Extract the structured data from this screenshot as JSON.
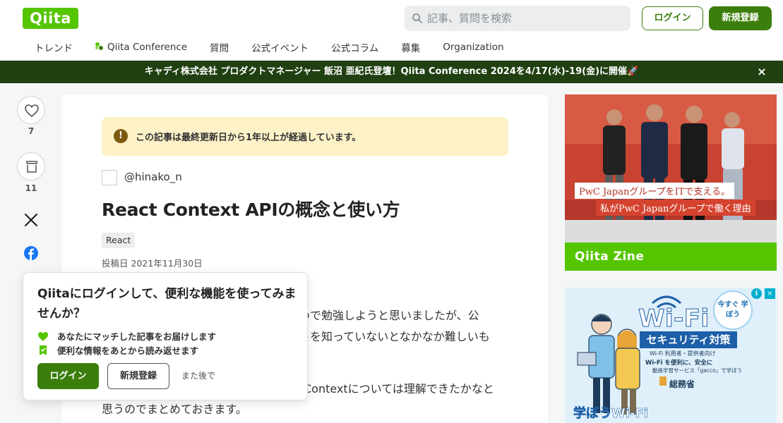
{
  "header": {
    "logo": "Qiita",
    "search_placeholder": "記事、質問を検索",
    "login_label": "ログイン",
    "signup_label": "新規登録"
  },
  "nav": {
    "items": [
      "トレンド",
      "Qiita Conference",
      "質問",
      "公式イベント",
      "公式コラム",
      "募集",
      "Organization"
    ]
  },
  "banner": {
    "text": "キャディ株式会社 プロダクトマネージャー 飯沼 亜紀氏登壇！Qiita Conference 2024を4/17(水)-19(金)に開催🚀",
    "close": "×"
  },
  "rail": {
    "like_count": "7",
    "stock_count": "11"
  },
  "article": {
    "notice": "この記事は最終更新日から1年以上が経過しています。",
    "notice_icon": "!",
    "author": "@hinako_n",
    "title": "React Context APIの概念と使い方",
    "tag": "React",
    "posted_label": "投稿日",
    "posted_date": "2021年11月30日",
    "body_line1": "ので勉強しようと思いましたが、公",
    "body_line2": "トを知っていないとなかなか難しいも",
    "body_line3": "Contextについては理解できたかなと",
    "body_line4": "思うのでまとめておきます。"
  },
  "modal": {
    "title": "Qiitaにログインして、便利な機能を使ってみませんか？",
    "benefit1": "あなたにマッチした記事をお届けします",
    "benefit2": "便利な情報をあとから読み返せます",
    "login_label": "ログイン",
    "signup_label": "新規登録",
    "later_label": "また後で"
  },
  "ads": {
    "ad1_caption1": "PwC JapanグループをITで支える。",
    "ad1_caption2": "私がPwC Japanグループで働く理由",
    "ad1_footer": "Qiita Zine",
    "ad2_badge": "今すぐ 学ぼう",
    "ad2_wifi": "Wi-Fi",
    "ad2_security": "セキュリティ対策",
    "ad2_sub1": "Wi-Fi 利用者・提供者向け",
    "ad2_sub2": "Wi-Fi を便利に、安全に",
    "ad2_sub3": "動画学習サービス「gacco」で学ぼう",
    "ad2_ministry": "総務省",
    "ad2_bottom": "学ぼうWi-Fi",
    "ad2_info": "i",
    "ad2_close": "×"
  },
  "colors": {
    "brand_green": "#55c500",
    "dark_green": "#3c7e0c",
    "banner_bg": "#204011",
    "notice_bg": "#fdf1c7"
  }
}
